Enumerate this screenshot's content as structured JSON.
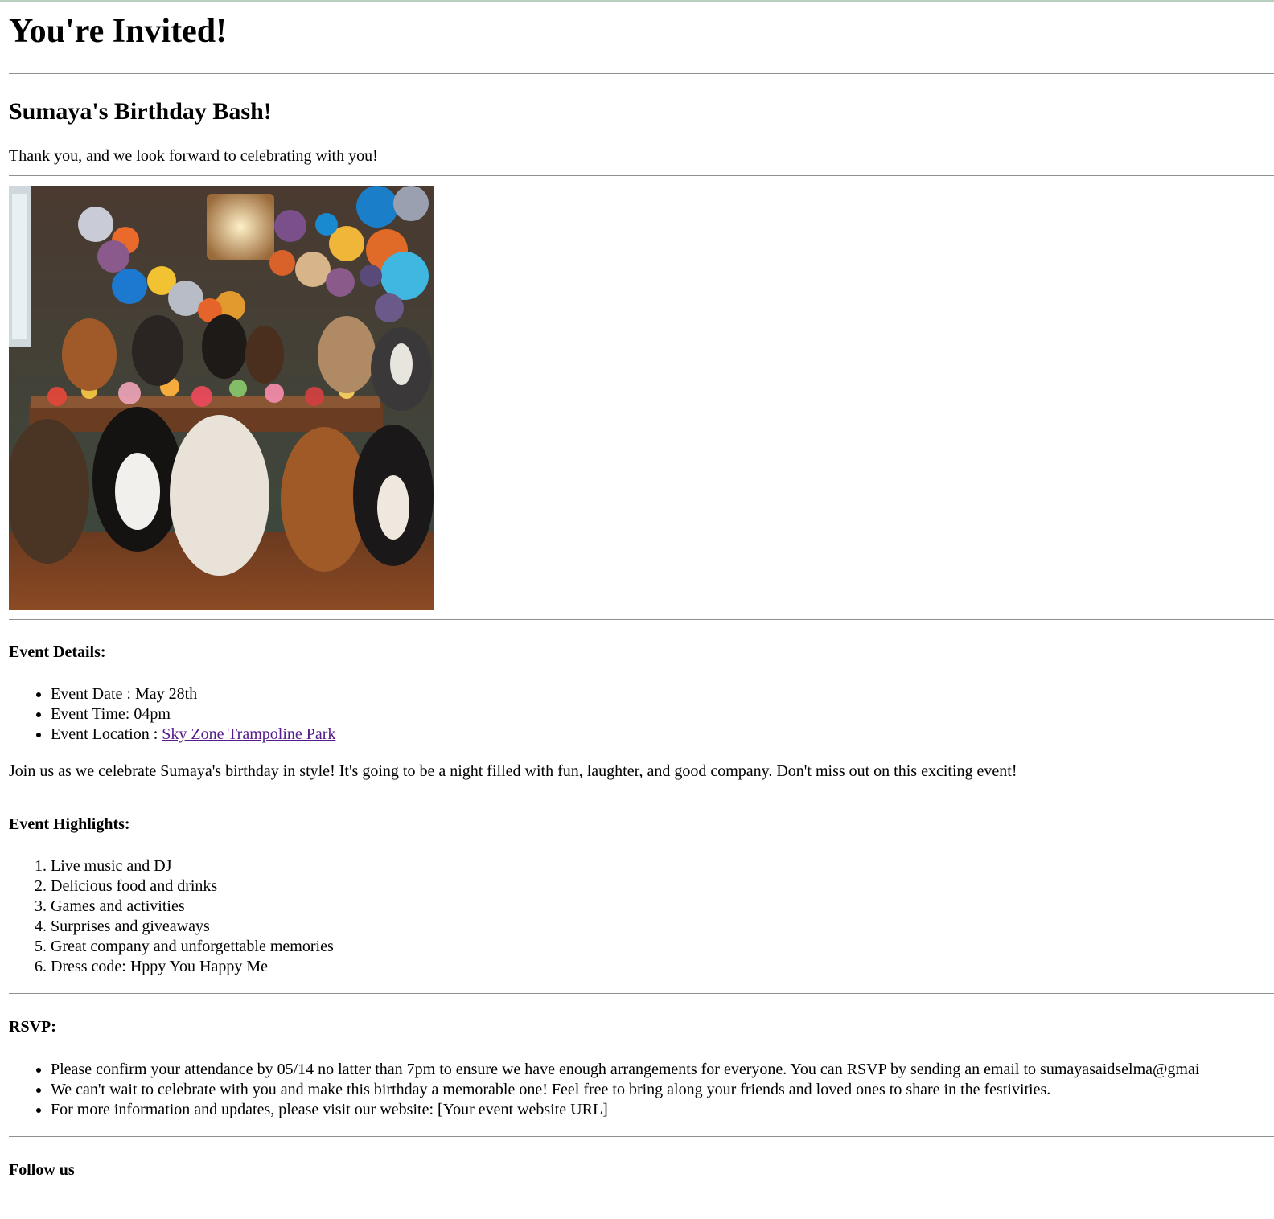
{
  "page": {
    "title": "You're Invited!",
    "subtitle": "Sumaya's Birthday Bash!",
    "intro": "Thank you, and we look forward to celebrating with you!"
  },
  "event_details": {
    "heading": "Event Details:",
    "date_label": "Event Date : May 28th",
    "time_label": "Event Time: 04pm",
    "location_prefix": "Event Location : ",
    "location_link": "Sky Zone Trampoline Park",
    "paragraph": "Join us as we celebrate Sumaya's birthday in style! It's going to be a night filled with fun, laughter, and good company. Don't miss out on this exciting event!"
  },
  "highlights": {
    "heading": "Event Highlights:",
    "items": [
      "Live music and DJ",
      "Delicious food and drinks",
      "Games and activities",
      "Surprises and giveaways",
      "Great company and unforgettable memories",
      "Dress code: Hppy You Happy Me"
    ]
  },
  "rsvp": {
    "heading": "RSVP:",
    "items": [
      "Please confirm your attendance by 05/14 no latter than 7pm to ensure we have enough arrangements for everyone. You can RSVP by sending an email to sumayasaidselma@gmai",
      "We can't wait to celebrate with you and make this birthday a memorable one! Feel free to bring along your friends and loved ones to share in the festivities.",
      "For more information and updates, please visit our website: [Your event website URL]"
    ]
  },
  "follow": {
    "heading": "Follow us"
  },
  "colors": {
    "link_visited": "#551a8b",
    "rule": "#8f8f8f",
    "topbar": "#b9cfbf"
  }
}
